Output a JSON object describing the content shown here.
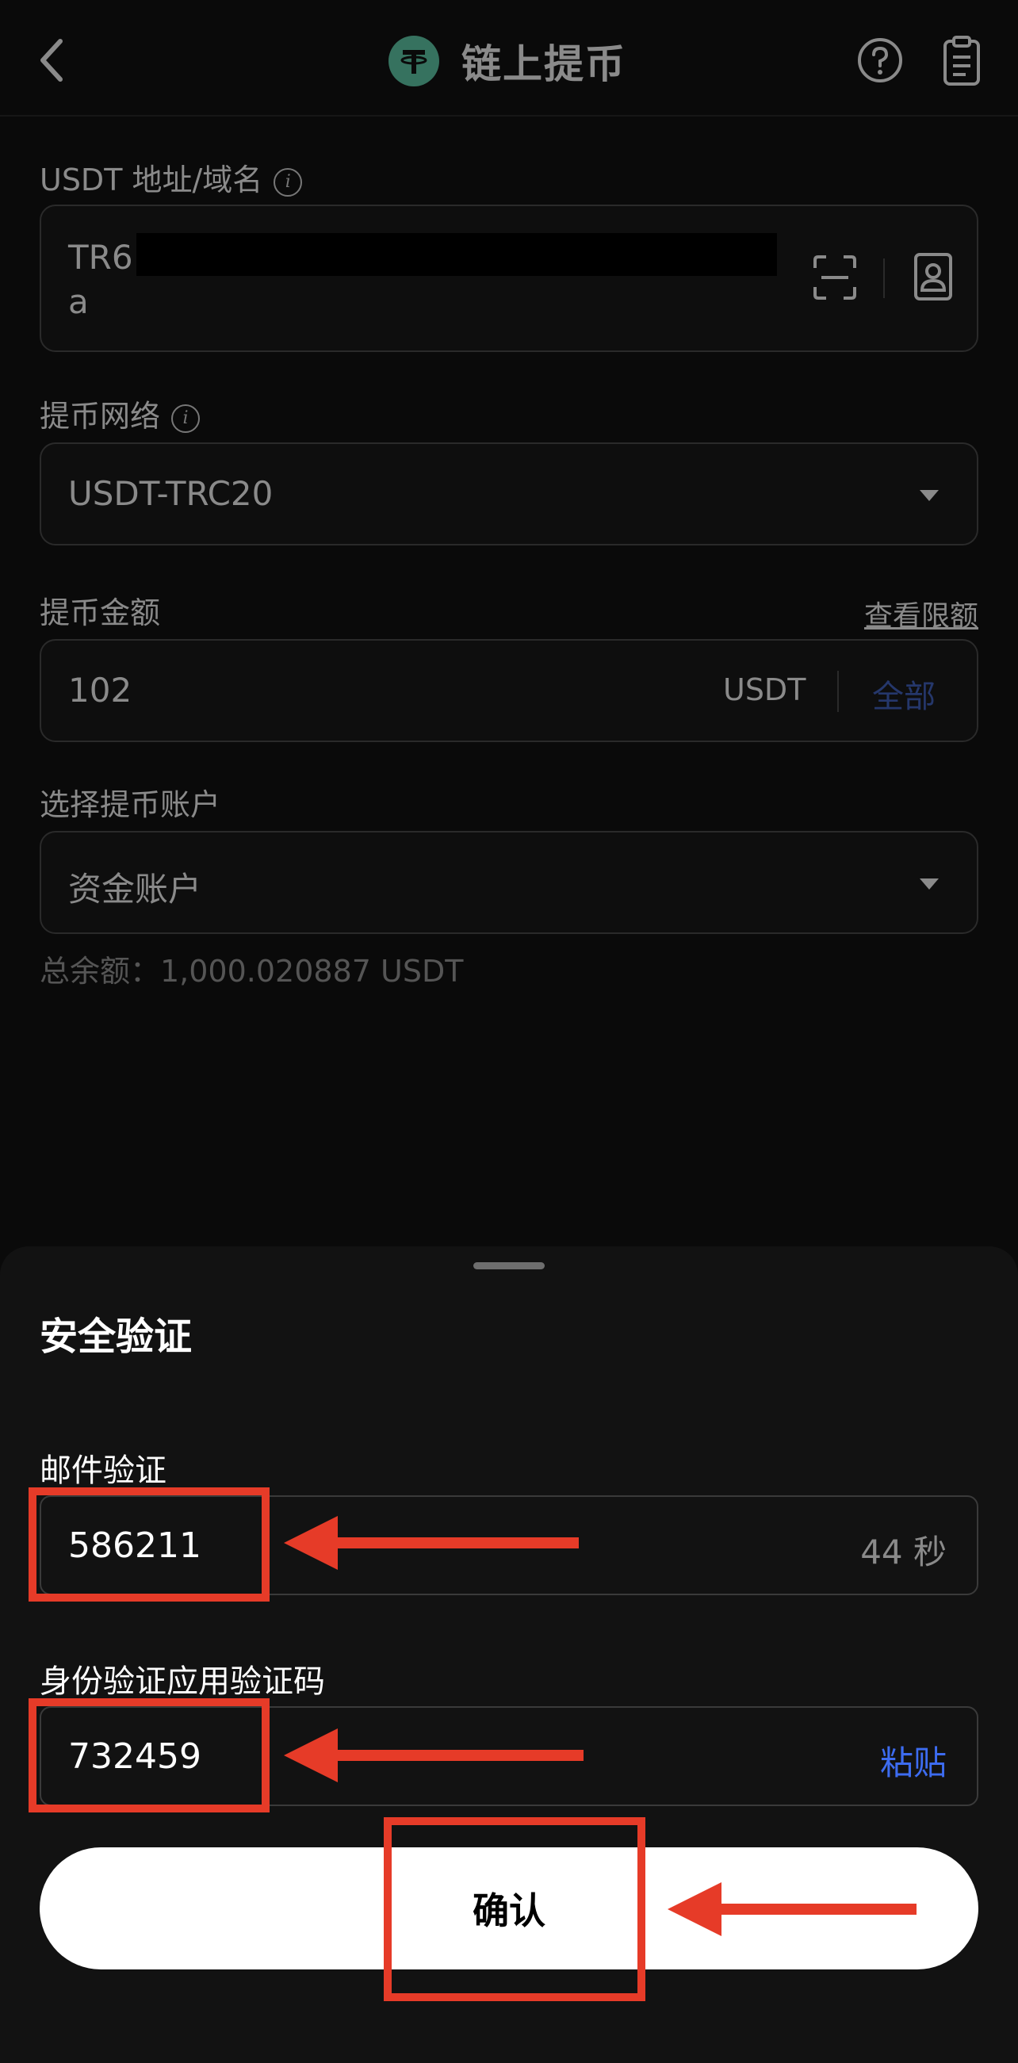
{
  "header": {
    "title": "链上提币",
    "back_icon": "chevron-left-icon",
    "coin_icon": "tether-icon",
    "help_icon": "question-circle-icon",
    "records_icon": "clipboard-icon"
  },
  "address": {
    "label": "USDT 地址/域名",
    "line1": "TR6",
    "line2": "a",
    "scan_icon": "scan-icon",
    "contacts_icon": "address-book-icon"
  },
  "network": {
    "label": "提币网络",
    "value": "USDT-TRC20"
  },
  "amount": {
    "label": "提币金额",
    "limit_link": "查看限额",
    "value": "102",
    "unit": "USDT",
    "max_label": "全部"
  },
  "account": {
    "label": "选择提币账户",
    "value": "资金账户",
    "balance": "总余额：1,000.020887 USDT"
  },
  "sheet": {
    "title": "安全验证",
    "email_label": "邮件验证",
    "email_code": "586211",
    "countdown": "44 秒",
    "auth_label": "身份验证应用验证码",
    "auth_code": "732459",
    "paste_label": "粘贴",
    "confirm_label": "确认"
  },
  "colors": {
    "accent_blue": "#3d6cf0",
    "annotation_red": "#e63b28",
    "coin_green": "#36725f"
  }
}
